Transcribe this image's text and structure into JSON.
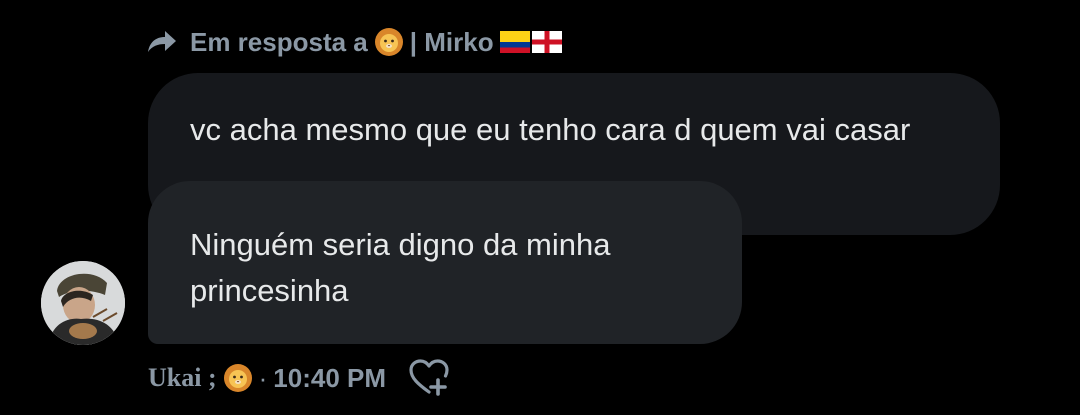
{
  "reply": {
    "prefix": "Em resposta a",
    "separator": "| Mirko",
    "emoji_icon": "lion-face-icon",
    "flags": [
      "colombia-flag-icon",
      "england-flag-icon"
    ]
  },
  "quoted_message": {
    "text": "vc acha mesmo que eu tenho cara d quem vai casar"
  },
  "message": {
    "text": "Ninguém seria digno da minha princesinha"
  },
  "meta": {
    "sender_name": "Ukai ;",
    "sender_emoji_icon": "lion-face-icon",
    "dot": "·",
    "time": "10:40 PM",
    "react_icon": "heart-plus-icon"
  },
  "colors": {
    "background": "#000000",
    "quoted_bubble": "#16181c",
    "message_bubble": "#202327",
    "text": "#e7e9ea",
    "secondary_text": "#8b98a5"
  }
}
